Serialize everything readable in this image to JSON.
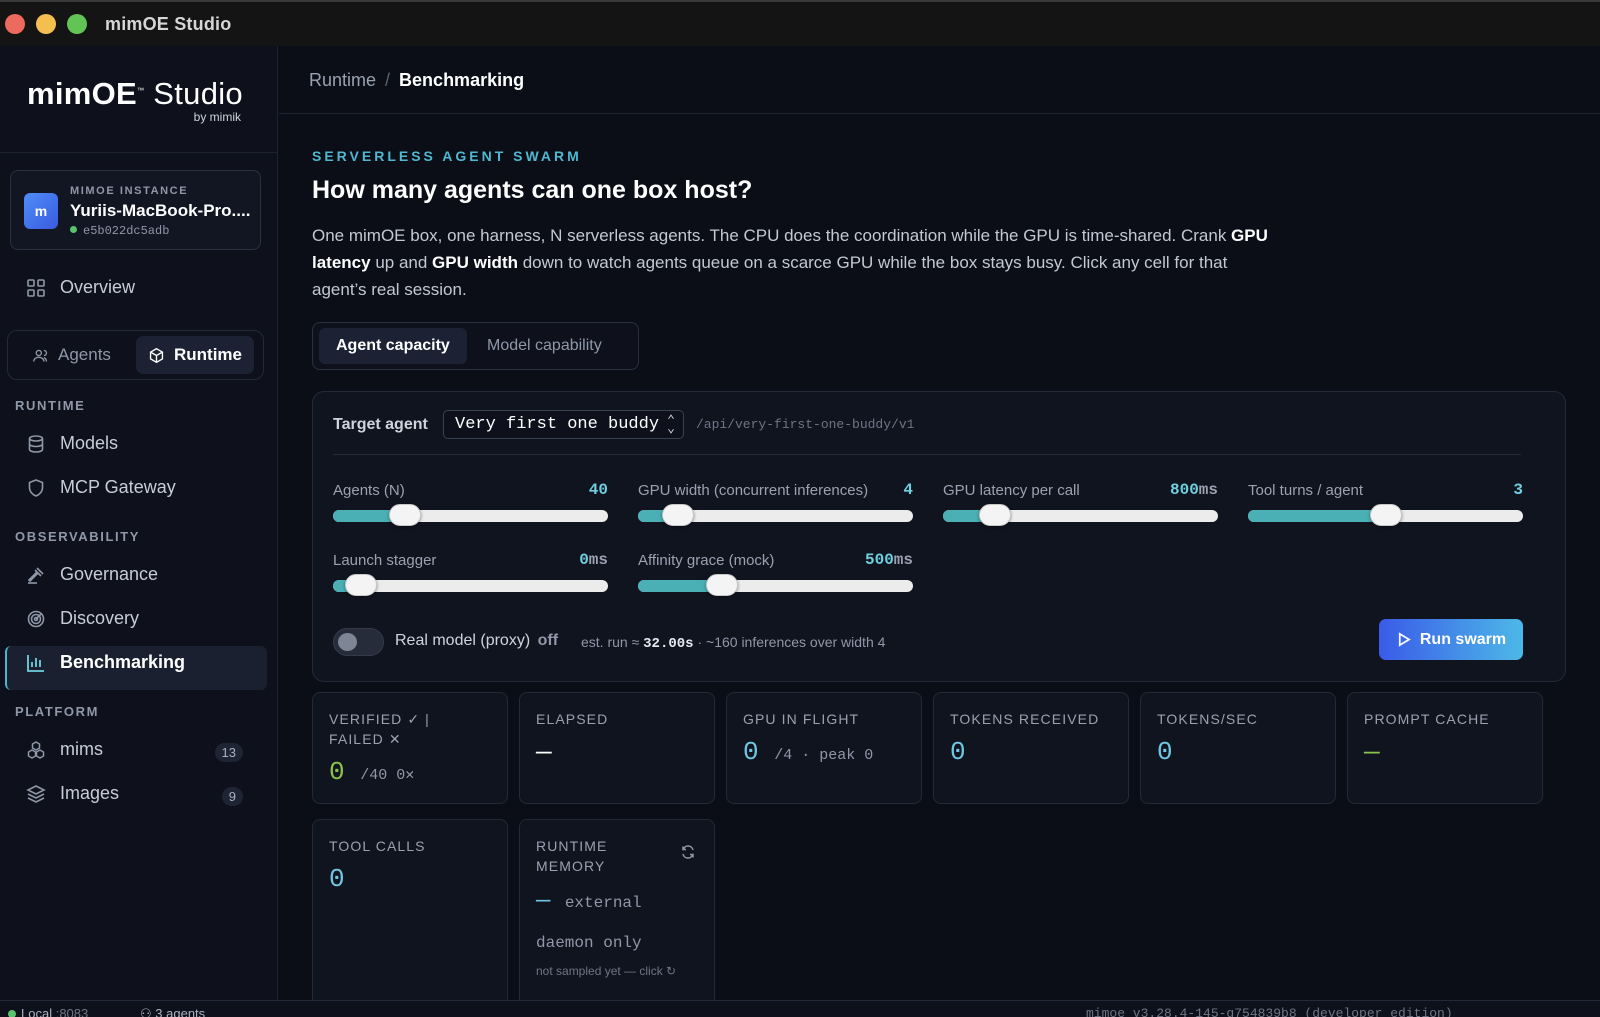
{
  "window": {
    "title": "mimOE Studio"
  },
  "brand": {
    "logo_main": "mimOE",
    "logo_tm": "™",
    "logo_studio": "Studio",
    "logo_by": "by mimik"
  },
  "instance": {
    "label": "MIMOE INSTANCE",
    "avatar_letter": "m",
    "name": "Yuriis-MacBook-Pro....",
    "id": "e5b022dc5adb"
  },
  "nav": {
    "overview": "Overview",
    "segment": {
      "agents": "Agents",
      "runtime": "Runtime"
    },
    "section_runtime": "RUNTIME",
    "models": "Models",
    "mcp_gateway": "MCP Gateway",
    "section_observability": "OBSERVABILITY",
    "governance": "Governance",
    "discovery": "Discovery",
    "benchmarking": "Benchmarking",
    "section_platform": "PLATFORM",
    "mims": "mims",
    "mims_count": "13",
    "images": "Images",
    "images_count": "9"
  },
  "breadcrumb": {
    "parent": "Runtime",
    "separator": "/",
    "current": "Benchmarking"
  },
  "header": {
    "eyebrow": "SERVERLESS AGENT SWARM",
    "title": "How many agents can one box host?",
    "desc_1": "One mimOE box, one harness, N serverless agents. The CPU does the coordination while the GPU is time-shared. Crank ",
    "desc_b1": "GPU latency",
    "desc_2": " up and ",
    "desc_b2": "GPU width",
    "desc_3": " down to watch agents queue on a scarce GPU while the box stays busy. Click any cell for that agent’s real session."
  },
  "tabs": {
    "agent_capacity": "Agent capacity",
    "model_capability": "Model capability"
  },
  "target": {
    "label": "Target agent",
    "selected": "Very first one buddy",
    "path": "/api/very-first-one-buddy/v1"
  },
  "sliders": {
    "agents": {
      "label": "Agents (N)",
      "value": "40",
      "unit": "",
      "fraction": 0.23
    },
    "gpu_width": {
      "label": "GPU width (concurrent inferences)",
      "value": "4",
      "unit": "",
      "fraction": 0.1
    },
    "gpu_latency": {
      "label": "GPU latency per call",
      "value": "800",
      "unit": "ms",
      "fraction": 0.15
    },
    "tool_turns": {
      "label": "Tool turns / agent",
      "value": "3",
      "unit": "",
      "fraction": 0.5
    },
    "launch_stagger": {
      "label": "Launch stagger",
      "value": "0",
      "unit": "ms",
      "fraction": 0.05
    },
    "affinity_grace": {
      "label": "Affinity grace (mock)",
      "value": "500",
      "unit": "ms",
      "fraction": 0.28
    }
  },
  "toggle": {
    "label": "Real model (proxy)",
    "state": "off"
  },
  "estimate": {
    "prefix": "est. run ≈ ",
    "value": "32.00s",
    "suffix": " · ~160 inferences over width 4"
  },
  "run_button": "Run swarm",
  "stats": {
    "verified": {
      "label": "VERIFIED ✓ | FAILED ✕",
      "value": "0",
      "sub": "/40 0✕"
    },
    "elapsed": {
      "label": "ELAPSED",
      "value": "—"
    },
    "gpu_in_flight": {
      "label": "GPU IN FLIGHT",
      "value": "0",
      "sub": "/4 · peak 0"
    },
    "tokens_received": {
      "label": "TOKENS RECEIVED",
      "value": "0"
    },
    "tokens_sec": {
      "label": "TOKENS/SEC",
      "value": "0"
    },
    "prompt_cache": {
      "label": "PROMPT CACHE",
      "value": "—"
    },
    "tool_calls": {
      "label": "TOOL CALLS",
      "value": "0"
    },
    "runtime_memory": {
      "label": "RUNTIME MEMORY",
      "value": "—",
      "value_sub": "external",
      "line2": "daemon only",
      "note": "not sampled yet — click ↻"
    }
  },
  "statusbar": {
    "local": "Local",
    "port": ":8083",
    "agents": "3 agents",
    "version": "mimoe v3.28.4-145-g754839b8 (developer edition)"
  },
  "colors": {
    "accent": "#4fb8d0",
    "value": "#6fc7e4",
    "verified": "#8bc34a",
    "cache": "#8bc34a",
    "slider_fill": "#4ab0b5"
  }
}
